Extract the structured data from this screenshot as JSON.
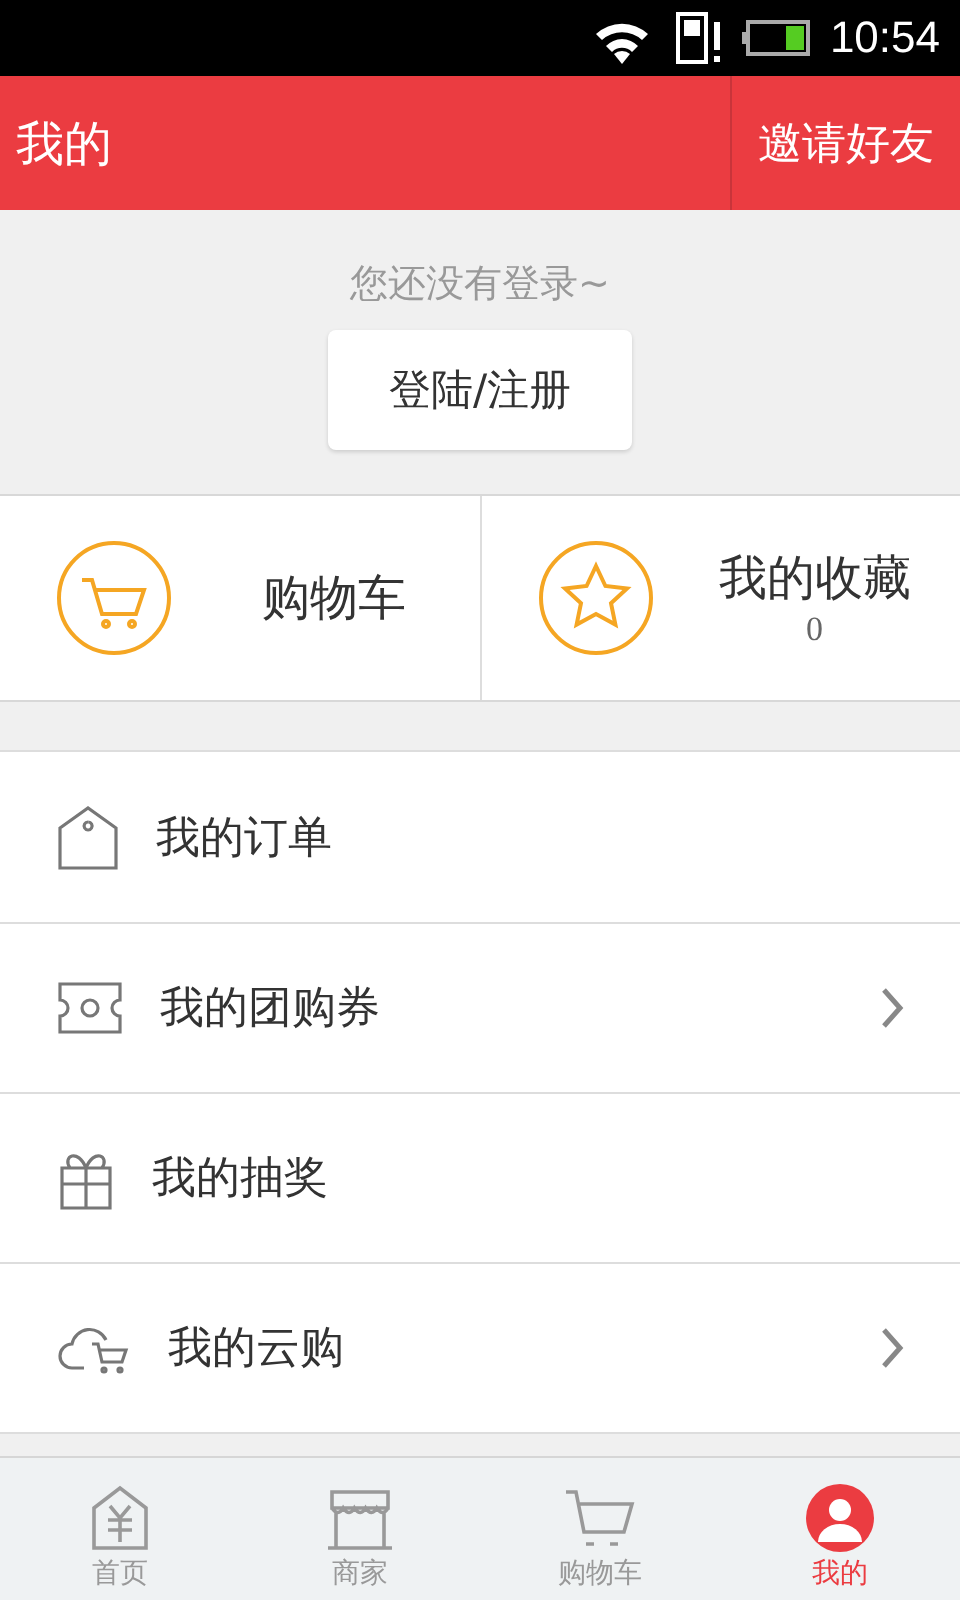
{
  "status_bar": {
    "time": "10:54"
  },
  "header": {
    "title": "我的",
    "action": "邀请好友"
  },
  "login": {
    "prompt": "您还没有登录~",
    "button": "登陆/注册"
  },
  "shortcuts": [
    {
      "kind": "cart",
      "label": "购物车"
    },
    {
      "kind": "star",
      "label": "我的收藏",
      "count": "0"
    }
  ],
  "menu": [
    {
      "kind": "tag",
      "label": "我的订单",
      "arrow": false
    },
    {
      "kind": "ticket",
      "label": "我的团购券",
      "arrow": true
    },
    {
      "kind": "gift",
      "label": "我的抽奖",
      "arrow": false
    },
    {
      "kind": "cloud",
      "label": "我的云购",
      "arrow": true
    }
  ],
  "tabs": [
    {
      "kind": "home",
      "label": "首页",
      "selected": false
    },
    {
      "kind": "shop",
      "label": "商家",
      "selected": false
    },
    {
      "kind": "cart",
      "label": "购物车",
      "selected": false
    },
    {
      "kind": "me",
      "label": "我的",
      "selected": true
    }
  ]
}
